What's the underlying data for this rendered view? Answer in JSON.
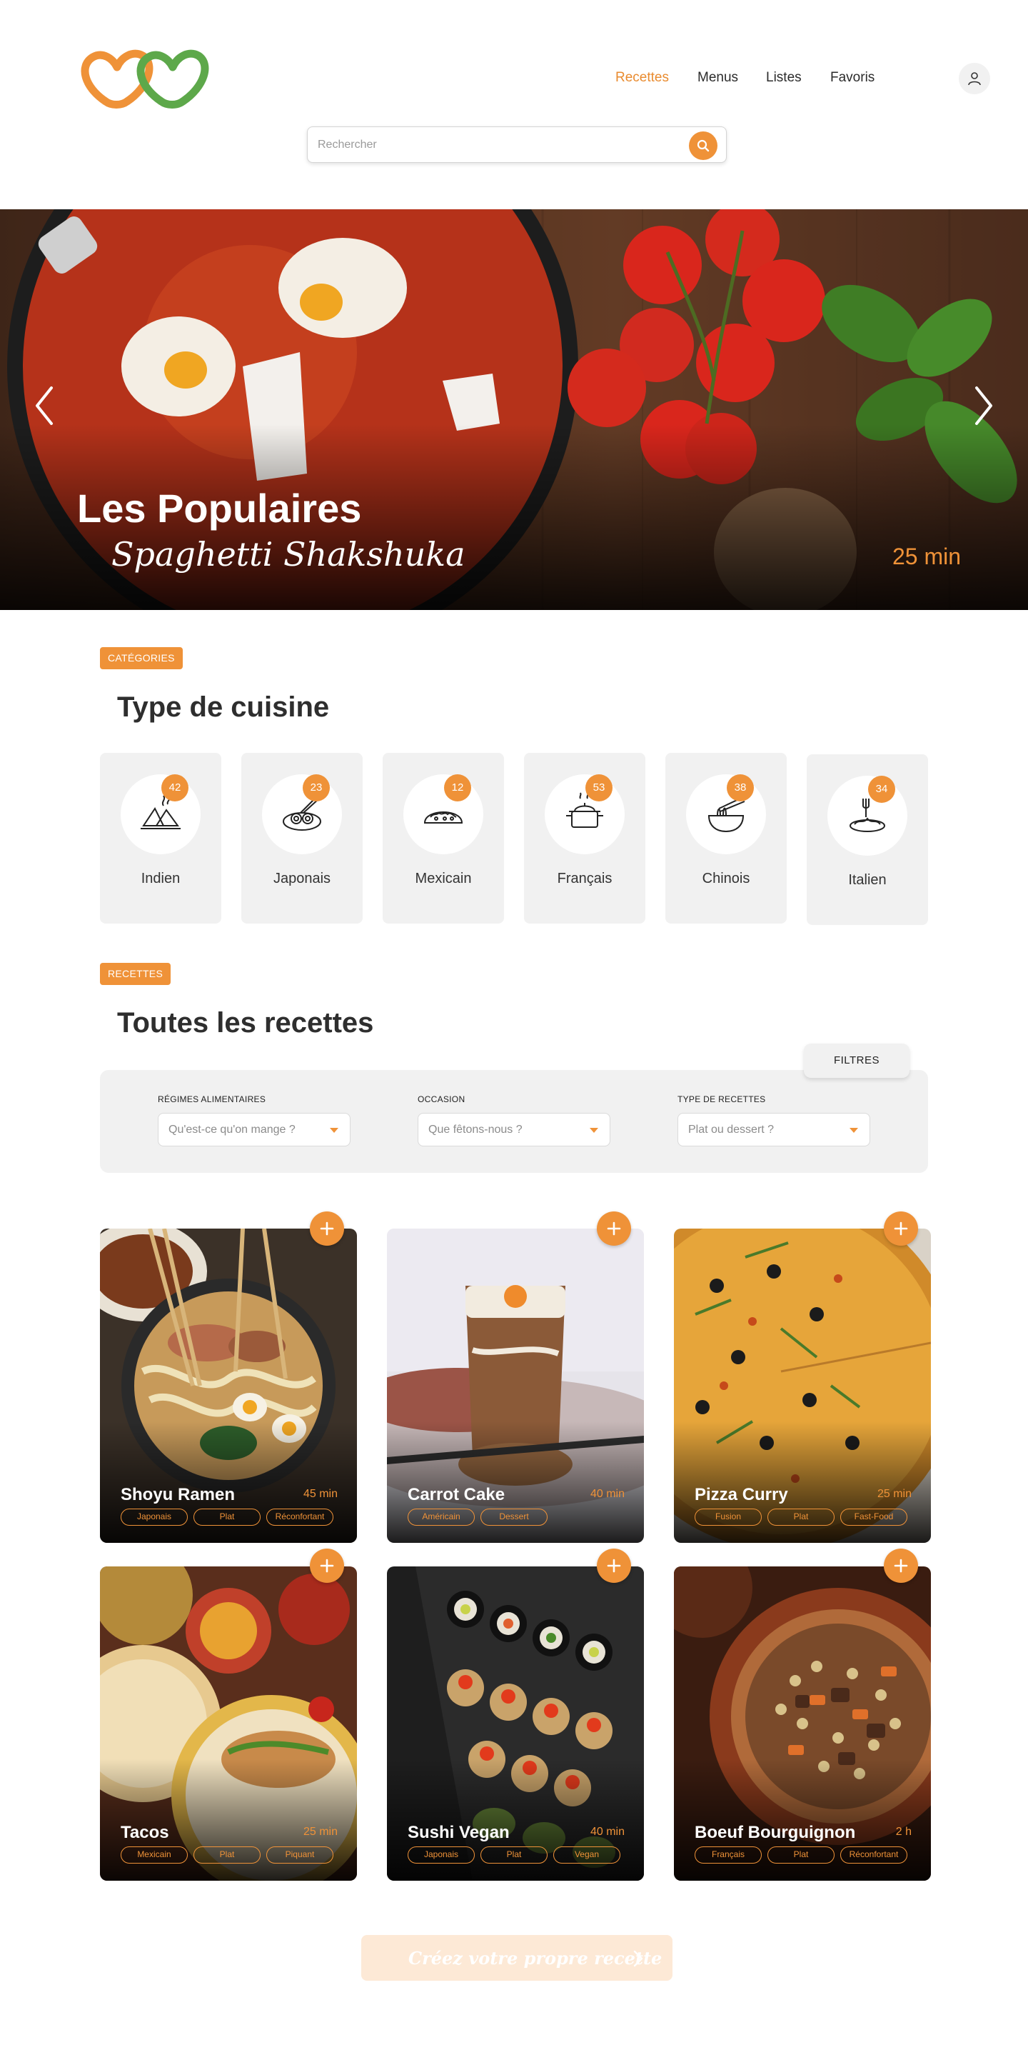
{
  "header": {
    "nav": [
      {
        "label": "Recettes",
        "active": true
      },
      {
        "label": "Menus"
      },
      {
        "label": "Listes"
      },
      {
        "label": "Favoris"
      }
    ],
    "search_placeholder": "Rechercher",
    "accent_color": "#ef9238",
    "logo_colors": [
      "#ef9238",
      "#5da84a"
    ]
  },
  "hero": {
    "title": "Les Populaires",
    "subtitle": "Spaghetti Shakshuka",
    "time": "25 min"
  },
  "categories": {
    "tag": "CATÉGORIES",
    "title": "Type de cuisine",
    "items": [
      {
        "label": "Indien",
        "count": "42",
        "icon": "samosa-icon"
      },
      {
        "label": "Japonais",
        "count": "23",
        "icon": "sushi-icon"
      },
      {
        "label": "Mexicain",
        "count": "12",
        "icon": "taco-icon"
      },
      {
        "label": "Français",
        "count": "53",
        "icon": "pot-icon"
      },
      {
        "label": "Chinois",
        "count": "38",
        "icon": "noodle-bowl-icon"
      },
      {
        "label": "Italien",
        "count": "34",
        "icon": "spaghetti-icon"
      }
    ]
  },
  "recipes": {
    "tag": "RECETTES",
    "title": "Toutes les recettes",
    "filters_label": "FILTRES",
    "filters": [
      {
        "label": "RÉGIMES ALIMENTAIRES",
        "placeholder": "Qu'est-ce qu'on mange ?"
      },
      {
        "label": "OCCASION",
        "placeholder": "Que fêtons-nous ?"
      },
      {
        "label": "TYPE DE RECETTES",
        "placeholder": "Plat ou dessert ?"
      }
    ],
    "cards": [
      {
        "title": "Shoyu Ramen",
        "time": "45 min",
        "tags": [
          "Japonais",
          "Plat",
          "Réconfortant"
        ]
      },
      {
        "title": "Carrot Cake",
        "time": "40 min",
        "tags": [
          "Américain",
          "Dessert"
        ]
      },
      {
        "title": "Pizza Curry",
        "time": "25 min",
        "tags": [
          "Fusion",
          "Plat",
          "Fast-Food"
        ]
      },
      {
        "title": "Tacos",
        "time": "25 min",
        "tags": [
          "Mexicain",
          "Plat",
          "Piquant"
        ]
      },
      {
        "title": "Sushi Vegan",
        "time": "40 min",
        "tags": [
          "Japonais",
          "Plat",
          "Vegan"
        ]
      },
      {
        "title": "Boeuf Bourguignon",
        "time": "2 h",
        "tags": [
          "Français",
          "Plat",
          "Réconfortant"
        ]
      }
    ]
  },
  "cta": {
    "label": "Créez votre propre recette"
  }
}
